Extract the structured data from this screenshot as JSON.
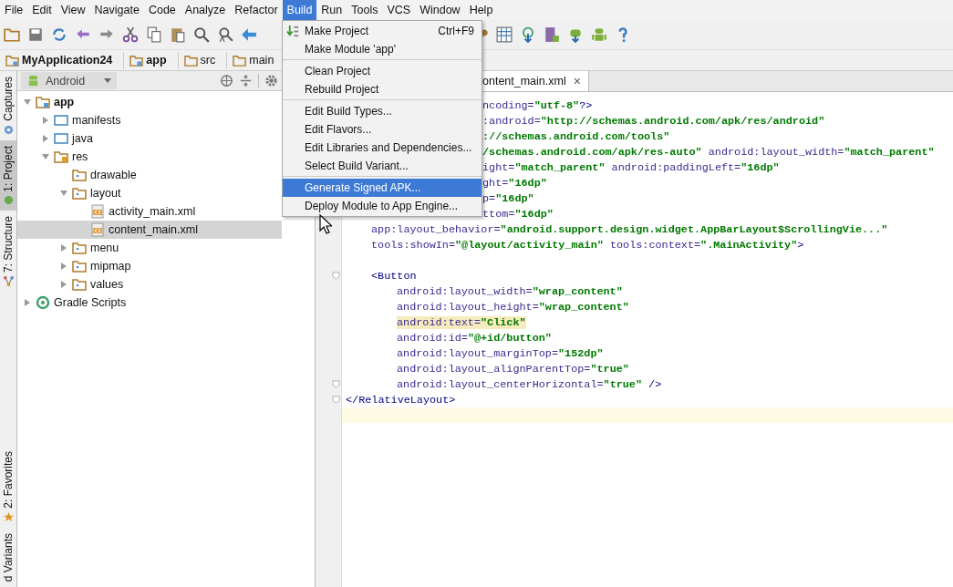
{
  "menubar": [
    {
      "label": "File",
      "selected": false
    },
    {
      "label": "Edit",
      "selected": false
    },
    {
      "label": "View",
      "selected": false
    },
    {
      "label": "Navigate",
      "selected": false
    },
    {
      "label": "Code",
      "selected": false
    },
    {
      "label": "Analyze",
      "selected": false
    },
    {
      "label": "Refactor",
      "selected": false
    },
    {
      "label": "Build",
      "selected": true
    },
    {
      "label": "Run",
      "selected": false
    },
    {
      "label": "Tools",
      "selected": false
    },
    {
      "label": "VCS",
      "selected": false
    },
    {
      "label": "Window",
      "selected": false
    },
    {
      "label": "Help",
      "selected": false
    }
  ],
  "build_menu": [
    {
      "kind": "item",
      "label": "Make Project",
      "shortcut": "Ctrl+F9",
      "icon": true,
      "selected": false
    },
    {
      "kind": "item",
      "label": "Make Module 'app'",
      "selected": false
    },
    {
      "kind": "separator"
    },
    {
      "kind": "item",
      "label": "Clean Project",
      "selected": false
    },
    {
      "kind": "item",
      "label": "Rebuild Project",
      "selected": false
    },
    {
      "kind": "separator"
    },
    {
      "kind": "item",
      "label": "Edit Build Types...",
      "selected": false
    },
    {
      "kind": "item",
      "label": "Edit Flavors...",
      "selected": false
    },
    {
      "kind": "item",
      "label": "Edit Libraries and Dependencies...",
      "selected": false
    },
    {
      "kind": "item",
      "label": "Select Build Variant...",
      "selected": false
    },
    {
      "kind": "separator"
    },
    {
      "kind": "item",
      "label": "Generate Signed APK...",
      "selected": true
    },
    {
      "kind": "item",
      "label": "Deploy Module to App Engine...",
      "selected": false
    }
  ],
  "breadcrumbs": [
    {
      "label": "MyApplication24",
      "kind": "module"
    },
    {
      "label": "app",
      "kind": "module"
    },
    {
      "label": "src",
      "kind": "folder"
    },
    {
      "label": "main",
      "kind": "folder"
    }
  ],
  "tool_strip": [
    {
      "label": "Captures",
      "kind": "captures",
      "selected": false
    },
    {
      "label": "1: Project",
      "kind": "android",
      "selected": true
    },
    {
      "label": "7: Structure",
      "kind": "structure",
      "selected": false
    },
    {
      "kind": "gap"
    },
    {
      "label": "2: Favorites",
      "kind": "star",
      "selected": false
    },
    {
      "label": "d Variants",
      "kind": "none",
      "selected": false
    }
  ],
  "project_panel": {
    "view": "Android",
    "tree": [
      {
        "label": "app",
        "kind": "module",
        "expanded": true,
        "selected": false,
        "children": [
          {
            "label": "manifests",
            "kind": "folder",
            "expanded": false,
            "selected": false
          },
          {
            "label": "java",
            "kind": "folder",
            "expanded": false,
            "selected": false
          },
          {
            "label": "res",
            "kind": "res",
            "expanded": true,
            "selected": false,
            "children": [
              {
                "label": "drawable",
                "kind": "resfolder",
                "selected": false
              },
              {
                "label": "layout",
                "kind": "resfolder",
                "expanded": true,
                "selected": false,
                "children": [
                  {
                    "label": "activity_main.xml",
                    "kind": "xml",
                    "selected": false
                  },
                  {
                    "label": "content_main.xml",
                    "kind": "xml",
                    "selected": true
                  }
                ]
              },
              {
                "label": "menu",
                "kind": "resfolder",
                "expanded": false,
                "selected": false
              },
              {
                "label": "mipmap",
                "kind": "resfolder",
                "expanded": false,
                "selected": false
              },
              {
                "label": "values",
                "kind": "resfolder",
                "expanded": false,
                "selected": false
              }
            ]
          }
        ]
      },
      {
        "label": "Gradle Scripts",
        "kind": "gradle",
        "expanded": false,
        "selected": false
      }
    ]
  },
  "editor": {
    "tab": "ontent_main.xml",
    "close": "×",
    "lines": [
      {
        "kind": "clipped",
        "tokens": [
          {
            "kind": "name",
            "s": "ncoding="
          },
          {
            "kind": "value",
            "s": "\"utf-8\""
          },
          {
            "kind": "tag",
            "s": "?>"
          }
        ]
      },
      {
        "kind": "clipped",
        "tokens": [
          {
            "kind": "name",
            "s": ":android="
          },
          {
            "kind": "value",
            "s": "\"http://schemas.android.com/apk/res/android\""
          }
        ]
      },
      {
        "kind": "clipped",
        "tokens": [
          {
            "kind": "value",
            "s": "://schemas.android.com/tools\""
          }
        ]
      },
      {
        "kind": "clipped",
        "tokens": [
          {
            "kind": "value",
            "s": "/schemas.android.com/apk/res-auto\""
          },
          {
            "kind": "name",
            "s": " android:layout_width="
          },
          {
            "kind": "value",
            "s": "\"match_parent\""
          }
        ]
      },
      {
        "kind": "clipped",
        "tokens": [
          {
            "kind": "name",
            "s": "ight="
          },
          {
            "kind": "value",
            "s": "\"match_parent\""
          },
          {
            "kind": "name",
            "s": " android:paddingLeft="
          },
          {
            "kind": "value",
            "s": "\"16dp\""
          }
        ]
      },
      {
        "kind": "clipped",
        "tokens": [
          {
            "kind": "name",
            "s": "ght="
          },
          {
            "kind": "value",
            "s": "\"16dp\""
          }
        ]
      },
      {
        "kind": "clipped",
        "tokens": [
          {
            "kind": "name",
            "s": "p="
          },
          {
            "kind": "value",
            "s": "\"16dp\""
          }
        ]
      },
      {
        "kind": "clipped",
        "tokens": [
          {
            "kind": "name",
            "s": "ttom="
          },
          {
            "kind": "value",
            "s": "\"16dp\""
          }
        ]
      },
      {
        "kind": "inner",
        "tokens": [
          {
            "kind": "name",
            "s": "app:layout_behavior="
          },
          {
            "kind": "value",
            "s": "\"android.support.design.widget.AppBarLayout$ScrollingVie...\""
          }
        ]
      },
      {
        "kind": "inner",
        "tokens": [
          {
            "kind": "name",
            "s": "tools:showIn="
          },
          {
            "kind": "value",
            "s": "\"@layout/activity_main\""
          },
          {
            "kind": "name",
            "s": " tools:context="
          },
          {
            "kind": "value",
            "s": "\".MainActivity\""
          },
          {
            "kind": "tag",
            "s": ">"
          }
        ]
      },
      {
        "kind": "blank"
      },
      {
        "kind": "inner",
        "fold": true,
        "tokens": [
          {
            "kind": "tag",
            "s": "<Button"
          }
        ]
      },
      {
        "kind": "attr",
        "tokens": [
          {
            "kind": "name",
            "s": "android:layout_width="
          },
          {
            "kind": "value",
            "s": "\"wrap_content\""
          }
        ]
      },
      {
        "kind": "attr",
        "tokens": [
          {
            "kind": "name",
            "s": "android:layout_height="
          },
          {
            "kind": "value",
            "s": "\"wrap_content\""
          }
        ]
      },
      {
        "kind": "attr",
        "highlighted": true,
        "tokens": [
          {
            "kind": "name",
            "s": "android:text="
          },
          {
            "kind": "value",
            "s": "\"Click\""
          }
        ]
      },
      {
        "kind": "attr",
        "tokens": [
          {
            "kind": "name",
            "s": "android:id="
          },
          {
            "kind": "value",
            "s": "\"@+id/button\""
          }
        ]
      },
      {
        "kind": "attr",
        "tokens": [
          {
            "kind": "name",
            "s": "android:layout_marginTop="
          },
          {
            "kind": "value",
            "s": "\"152dp\""
          }
        ]
      },
      {
        "kind": "attr",
        "tokens": [
          {
            "kind": "name",
            "s": "android:layout_alignParentTop="
          },
          {
            "kind": "value",
            "s": "\"true\""
          }
        ]
      },
      {
        "kind": "attr",
        "fold": true,
        "tokens": [
          {
            "kind": "name",
            "s": "android:layout_centerHorizontal="
          },
          {
            "kind": "value",
            "s": "\"true\""
          },
          {
            "kind": "tag",
            "s": " />"
          }
        ]
      },
      {
        "kind": "top",
        "fold": true,
        "tokens": [
          {
            "kind": "tag",
            "s": "</RelativeLayout>"
          }
        ]
      },
      {
        "kind": "blank",
        "current": true
      }
    ]
  }
}
